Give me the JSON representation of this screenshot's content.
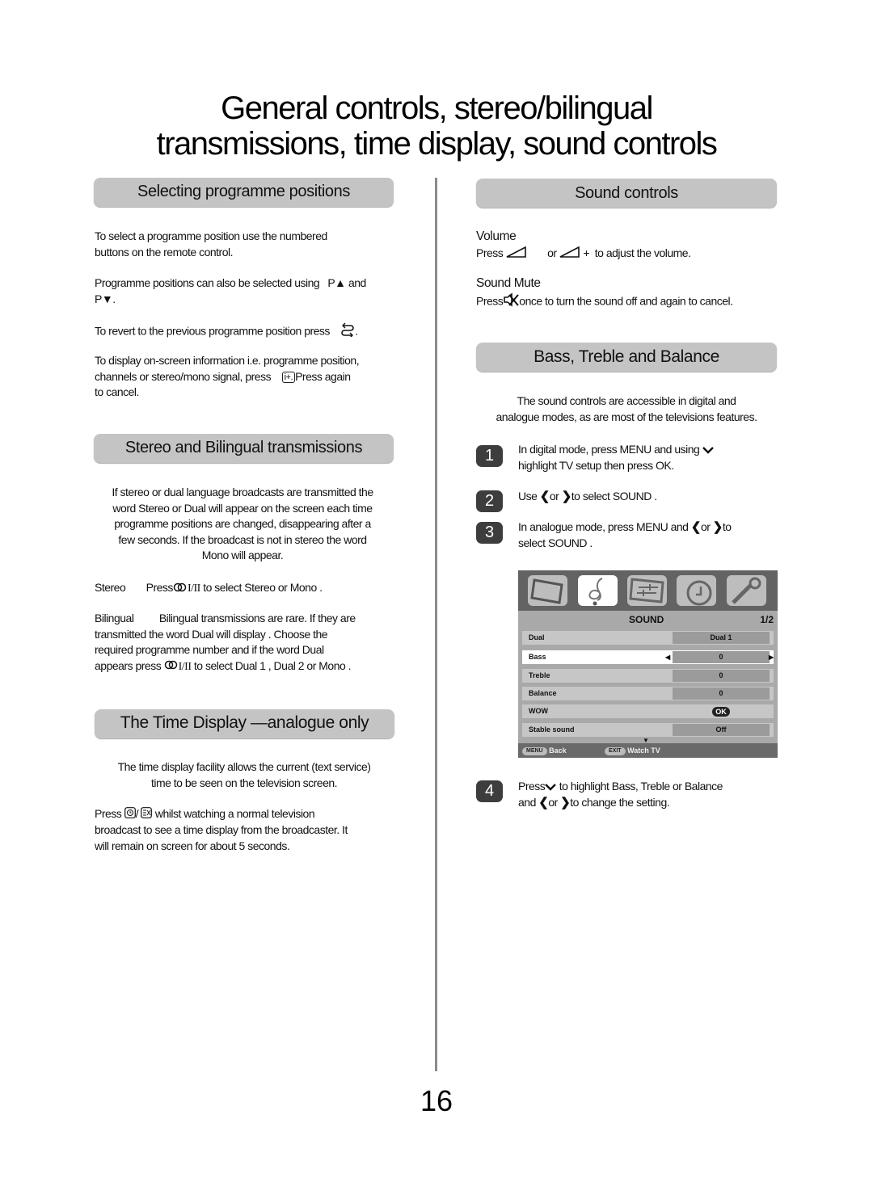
{
  "page": {
    "title_line1": "General controls, stereo/bilingual",
    "title_line2": "transmissions, time display, sound controls",
    "page_number": "16"
  },
  "left": {
    "selecting": {
      "heading": "Selecting programme positions",
      "p1_line1": "To select a programme position use the numbered",
      "p1_line2": "buttons on the remote control.",
      "p2_a": "Programme positions can also be selected using",
      "p2_up": "P▲",
      "p2_and": "and",
      "p2_down": "P▼.",
      "p3": "To revert to the previous programme position press",
      "p3_icon": "return-icon",
      "p4_line1": "To display on-screen information   i.e. programme position,",
      "p4_line2a": "channels or stereo/mono signal, press",
      "p4_key": "i+.",
      "p4_line2b": "Press again",
      "p4_line3": "to cancel."
    },
    "stereo": {
      "heading": "Stereo and Bilingual transmissions",
      "intro": [
        "If stereo or dual language broadcasts are transmitted the",
        "word Stereo or Dual will appear on the screen each time",
        "programme positions are changed, disappearing after a",
        "few seconds. If the broadcast is not in stereo the word",
        "Mono will appear."
      ],
      "stereo_label": "Stereo",
      "stereo_text_a": "Press",
      "stereo_key": "I/II",
      "stereo_text_b": "to select Stereo  or Mono .",
      "bilingual_label": "Bilingual",
      "bilingual_line1": "Bilingual transmissions are rare. If they   are",
      "bilingual_line2": "transmitted the word  Dual  will display . Choose the",
      "bilingual_line3": "required programme number and if the word     Dual",
      "bilingual_line4a": "appears press",
      "bilingual_key": "I/II",
      "bilingual_line4b": "to select Dual 1 , Dual 2  or Mono ."
    },
    "time": {
      "heading": "The Time Display —analogue   only",
      "intro_line1": "The time display facility allows the current (text service)",
      "intro_line2": "time to be seen on the television screen.",
      "p_a": "Press",
      "p_sep": "/",
      "p_b": "whilst watching a normal television",
      "p_line2": "broadcast to see a time display from the broadcaster. It",
      "p_line3": "will remain on screen for about 5 seconds."
    }
  },
  "right": {
    "sound": {
      "heading": "Sound controls",
      "volume_title": "Volume",
      "volume_a": "Press",
      "volume_or": "or",
      "volume_plus": "+",
      "volume_b": "to adjust the volume.",
      "mute_title": "Sound Mute",
      "mute_a": "Press",
      "mute_b": "once to turn the sound off and again to cancel."
    },
    "btb": {
      "heading": "Bass, Treble and Balance",
      "intro_line1": "The sound controls are accessible in digital    and",
      "intro_line2": "analogue    modes, as are most of the televisions features.",
      "steps": [
        {
          "num": "1",
          "line1a": "In digital    mode, press MENU  and using",
          "line2": "highlight  TV setup  then press OK."
        },
        {
          "num": "2",
          "a": "Use",
          "or": "or",
          "b": "to select SOUND ."
        },
        {
          "num": "3",
          "a": "In analogue    mode, press MENU  and",
          "or": "or",
          "b": "to",
          "line2": "select SOUND ."
        },
        {
          "num": "4",
          "a": "Press",
          "b": "to highlight   Bass, Treble   or Balance",
          "line2a": "and",
          "or": "or",
          "line2b": "to change the setting."
        }
      ]
    },
    "tv_menu": {
      "icons": [
        "picture-icon",
        "sound-icon",
        "settings-icon",
        "timer-icon",
        "setup-icon"
      ],
      "active_index": 1,
      "title": "SOUND",
      "page": "1/2",
      "rows": [
        {
          "label": "Dual",
          "value": "Dual 1"
        },
        {
          "label": "Bass",
          "value": "0",
          "selected": true
        },
        {
          "label": "Treble",
          "value": "0"
        },
        {
          "label": "Balance",
          "value": "0"
        },
        {
          "label": "WOW",
          "value": "OK"
        },
        {
          "label": "Stable sound",
          "value": "Off"
        }
      ],
      "footer": {
        "menu_key": "MENU",
        "back": "Back",
        "exit_key": "EXIT",
        "watch": "Watch TV"
      }
    }
  }
}
